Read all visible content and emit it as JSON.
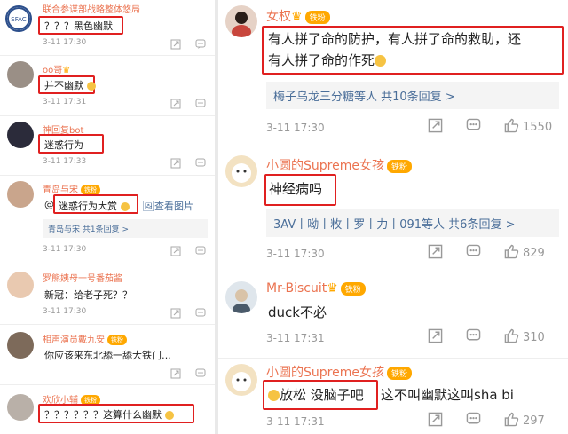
{
  "left_comments": [
    {
      "name": "联合参谋部战略整体悠局",
      "badge": "",
      "text": "？？？黑色幽默",
      "time": "3-11 17:30"
    },
    {
      "name": "oo哥",
      "badge": "",
      "text": "并不幽默",
      "time": "3-11 17:31"
    },
    {
      "name": "神回复bot",
      "badge": "",
      "text": "迷惑行为",
      "time": "3-11 17:33"
    },
    {
      "name": "青岛与宋",
      "badge": "铁粉",
      "text_prefix": "@",
      "text": "迷惑行为大赏",
      "link": "查看图片",
      "reply": "青岛与宋 共1条回复 >",
      "time": "3-11 17:30"
    },
    {
      "name": "罗熊姨母一号番茄酱",
      "badge": "",
      "text": "新冠：给老子死？？",
      "time": "3-11 17:30"
    },
    {
      "name": "相声演员戴九安",
      "badge": "铁粉",
      "text": "你应该来东北舔一舔大铁门…",
      "time": "3-11 17:30"
    },
    {
      "name": "欢欣小辅",
      "badge": "铁粉",
      "text": "？？？？？？这算什么幽默",
      "time": ""
    }
  ],
  "right_comments": [
    {
      "name": "女权",
      "badge": "铁粉",
      "text_line1": "有人拼了命的防护，有人拼了命的救助，还",
      "text_line2": "有人拼了命的作死",
      "reply": "梅子乌龙三分糖等人 共10条回复 >",
      "time": "3-11 17:30",
      "likes": "1550"
    },
    {
      "name": "小圆的Supreme女孩",
      "badge": "铁粉",
      "text": "神经病吗",
      "reply": "3AV丨呦丨敉丨罗丨力丨091等人 共6条回复 >",
      "time": "3-11 17:30",
      "likes": "829"
    },
    {
      "name": "Mr-Biscuit",
      "badge": "铁粉",
      "text": "duck不必",
      "time": "3-11 17:31",
      "likes": "310"
    },
    {
      "name": "小圆的Supreme女孩",
      "badge": "铁粉",
      "text_boxed": "放松 没脑子吧",
      "text_rest": "这不叫幽默这叫sha bi",
      "time": "3-11 17:31",
      "likes": "297"
    }
  ],
  "icons": {
    "share": "share-icon",
    "comment": "comment-icon",
    "like": "like-icon"
  },
  "colors": {
    "name": "#eb7350",
    "highlight_box": "#e02020",
    "reply_link": "#4a6e99",
    "badge": "#ffa800"
  }
}
